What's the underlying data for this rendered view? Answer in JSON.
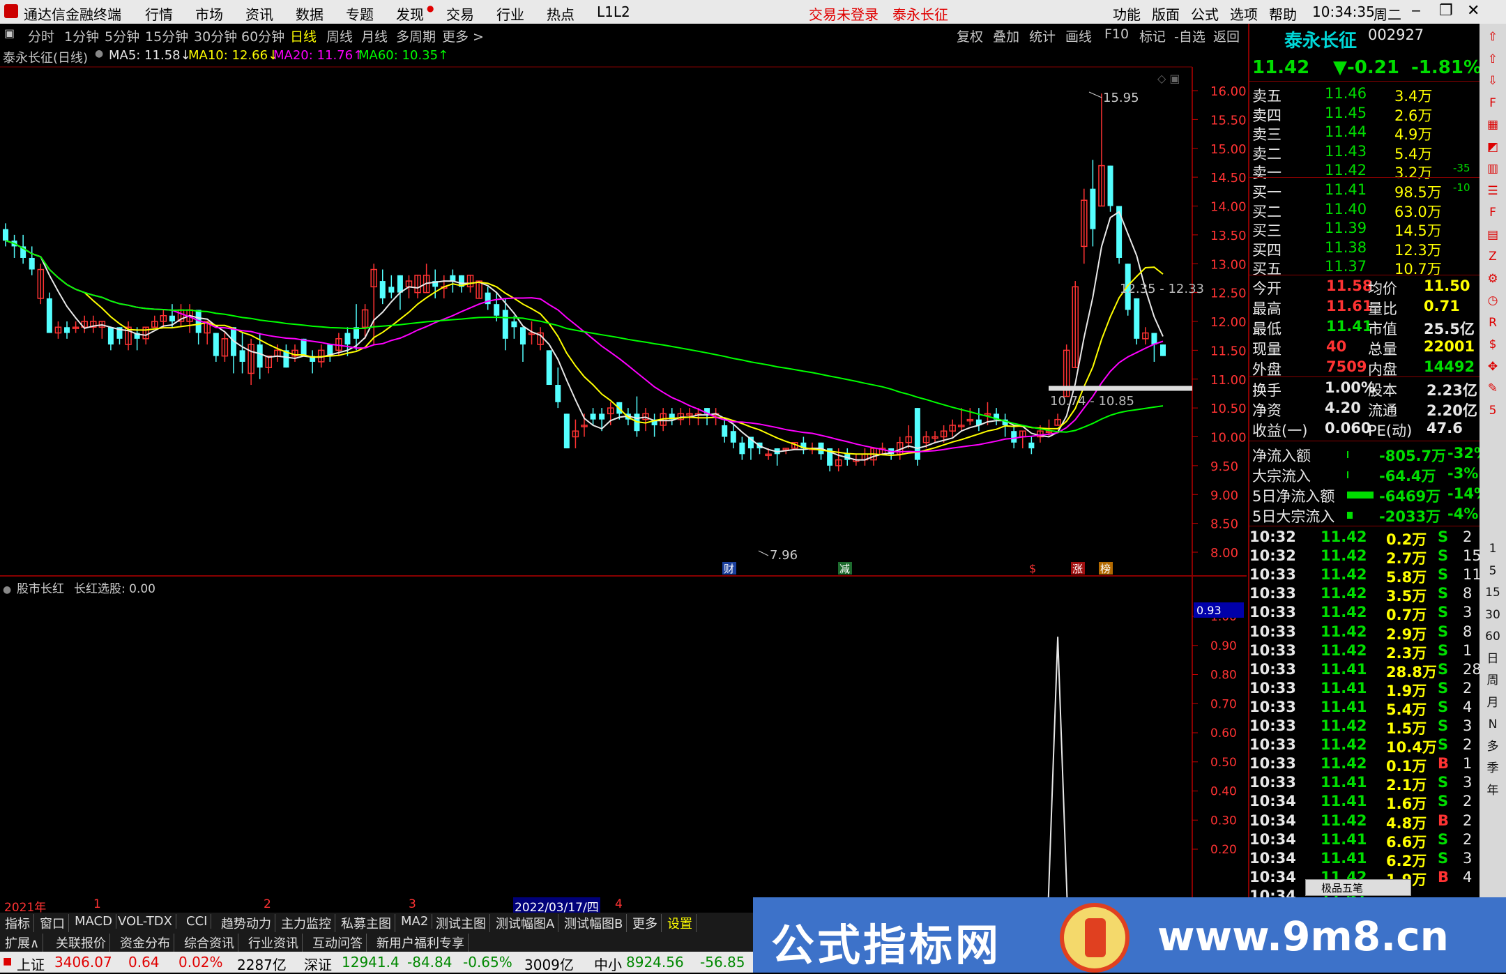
{
  "menubar": {
    "app_title": "通达信金融终端",
    "items": [
      "行情",
      "市场",
      "资讯",
      "数据",
      "专题",
      "发现",
      "交易",
      "行业",
      "热点",
      "L1L2"
    ],
    "notice1": "交易未登录",
    "notice2": "泰永长征",
    "right_items": [
      "功能",
      "版面",
      "公式",
      "选项",
      "帮助"
    ],
    "time": "10:34:35",
    "weekday": "周二"
  },
  "periods": [
    "分时",
    "1分钟",
    "5分钟",
    "15分钟",
    "30分钟",
    "60分钟",
    "日线",
    "周线",
    "月线",
    "多周期",
    "更多 >"
  ],
  "active_period": "日线",
  "tools": [
    "复权",
    "叠加",
    "统计",
    "画线",
    "F10",
    "标记",
    "-自选",
    "返回"
  ],
  "chart_title": {
    "stock": "泰永长征(日线)",
    "ma5": "MA5: 11.58↓",
    "ma10": "MA10: 12.66↓",
    "ma20": "MA20: 11.76↑",
    "ma60": "MA60: 10.35↑"
  },
  "price_axis": [
    "16.00",
    "15.50",
    "15.00",
    "14.50",
    "14.00",
    "13.50",
    "13.00",
    "12.50",
    "12.00",
    "11.50",
    "11.00",
    "10.50",
    "10.00",
    "9.50",
    "9.00",
    "8.50",
    "8.00"
  ],
  "annotations": {
    "high": "15.95",
    "low": "7.96",
    "range1": "12.35 - 12.33",
    "range2": "10.74 - 10.85",
    "events": [
      "财",
      "减",
      "$",
      "涨",
      "榜"
    ]
  },
  "indicator": {
    "title": "股市长红",
    "value_label": "长红选股: 0.00",
    "axis": [
      "1.00",
      "0.90",
      "0.80",
      "0.70",
      "0.60",
      "0.50",
      "0.40",
      "0.30",
      "0.20"
    ],
    "current": "0.93"
  },
  "time_axis": [
    "2021年",
    "1",
    "2",
    "3",
    "2022/03/17/四",
    "4"
  ],
  "tabs1": [
    "指标",
    "窗口",
    "MACD",
    "VOL-TDX",
    "CCI",
    "趋势动力",
    "主力监控",
    "私募主图",
    "MA2",
    "测试主图",
    "测试幅图A",
    "测试幅图B",
    "更多",
    "设置"
  ],
  "tabs2": [
    "扩展∧",
    "关联报价",
    "资金分布",
    "综合资讯",
    "行业资讯",
    "互动问答",
    "新用户福利专享"
  ],
  "status": {
    "sh_label": "上证",
    "sh_val": "3406.07",
    "sh_chg": "0.64",
    "sh_pct": "0.02%",
    "sh_amt": "2287亿",
    "sz_label": "深证",
    "sz_val": "12941.4",
    "sz_chg": "-84.84",
    "sz_pct": "-0.65%",
    "sz_amt": "3009亿",
    "zx_label": "中小",
    "zx_val": "8924.56",
    "zx_chg": "-56.85"
  },
  "quote": {
    "name": "泰永长征",
    "code": "002927",
    "price": "11.42",
    "change": "▼-0.21",
    "pct": "-1.81%",
    "asks": [
      {
        "label": "卖五",
        "price": "11.46",
        "vol": "3.4万",
        "chg": ""
      },
      {
        "label": "卖四",
        "price": "11.45",
        "vol": "2.6万",
        "chg": ""
      },
      {
        "label": "卖三",
        "price": "11.44",
        "vol": "4.9万",
        "chg": ""
      },
      {
        "label": "卖二",
        "price": "11.43",
        "vol": "5.4万",
        "chg": ""
      },
      {
        "label": "卖一",
        "price": "11.42",
        "vol": "3.2万",
        "chg": "-35"
      }
    ],
    "bids": [
      {
        "label": "买一",
        "price": "11.41",
        "vol": "98.5万",
        "chg": "-10"
      },
      {
        "label": "买二",
        "price": "11.40",
        "vol": "63.0万",
        "chg": ""
      },
      {
        "label": "买三",
        "price": "11.39",
        "vol": "14.5万",
        "chg": ""
      },
      {
        "label": "买四",
        "price": "11.38",
        "vol": "12.3万",
        "chg": ""
      },
      {
        "label": "买五",
        "price": "11.37",
        "vol": "10.7万",
        "chg": ""
      }
    ],
    "stats": [
      {
        "l1": "今开",
        "v1": "11.58",
        "l2": "均价",
        "v2": "11.50"
      },
      {
        "l1": "最高",
        "v1": "11.61",
        "l2": "量比",
        "v2": "0.71"
      },
      {
        "l1": "最低",
        "v1": "11.41",
        "l2": "市值",
        "v2": "25.5亿"
      },
      {
        "l1": "现量",
        "v1": "40",
        "l2": "总量",
        "v2": "22001"
      },
      {
        "l1": "外盘",
        "v1": "7509",
        "l2": "内盘",
        "v2": "14492"
      }
    ],
    "stats2": [
      {
        "l1": "换手",
        "v1": "1.00%",
        "l2": "股本",
        "v2": "2.23亿"
      },
      {
        "l1": "净资",
        "v1": "4.20",
        "l2": "流通",
        "v2": "2.20亿"
      },
      {
        "l1": "收益(一)",
        "v1": "0.060",
        "l2": "PE(动)",
        "v2": "47.6"
      }
    ],
    "flows": [
      {
        "label": "净流入额",
        "val": "-805.7万",
        "pct": "-32%"
      },
      {
        "label": "大宗流入",
        "val": "-64.4万",
        "pct": "-3%"
      },
      {
        "label": "5日净流入额",
        "val": "-6469万",
        "pct": "-14%"
      },
      {
        "label": "5日大宗流入",
        "val": "-2033万",
        "pct": "-4%"
      }
    ],
    "ticks": [
      {
        "t": "10:32",
        "p": "11.42",
        "v": "0.2万",
        "s": "S",
        "n": "2"
      },
      {
        "t": "10:32",
        "p": "11.42",
        "v": "2.7万",
        "s": "S",
        "n": "15"
      },
      {
        "t": "10:33",
        "p": "11.42",
        "v": "5.8万",
        "s": "S",
        "n": "11"
      },
      {
        "t": "10:33",
        "p": "11.42",
        "v": "3.5万",
        "s": "S",
        "n": "8"
      },
      {
        "t": "10:33",
        "p": "11.42",
        "v": "0.7万",
        "s": "S",
        "n": "3"
      },
      {
        "t": "10:33",
        "p": "11.42",
        "v": "2.9万",
        "s": "S",
        "n": "8"
      },
      {
        "t": "10:33",
        "p": "11.42",
        "v": "2.3万",
        "s": "S",
        "n": "1"
      },
      {
        "t": "10:33",
        "p": "11.41",
        "v": "28.8万",
        "s": "S",
        "n": "28"
      },
      {
        "t": "10:33",
        "p": "11.41",
        "v": "1.9万",
        "s": "S",
        "n": "2"
      },
      {
        "t": "10:33",
        "p": "11.41",
        "v": "5.4万",
        "s": "S",
        "n": "4"
      },
      {
        "t": "10:33",
        "p": "11.42",
        "v": "1.5万",
        "s": "S",
        "n": "3"
      },
      {
        "t": "10:33",
        "p": "11.42",
        "v": "10.4万",
        "s": "S",
        "n": "2"
      },
      {
        "t": "10:33",
        "p": "11.42",
        "v": "0.1万",
        "s": "B",
        "n": "1"
      },
      {
        "t": "10:33",
        "p": "11.41",
        "v": "2.1万",
        "s": "S",
        "n": "3"
      },
      {
        "t": "10:34",
        "p": "11.41",
        "v": "1.6万",
        "s": "S",
        "n": "2"
      },
      {
        "t": "10:34",
        "p": "11.42",
        "v": "4.8万",
        "s": "B",
        "n": "2"
      },
      {
        "t": "10:34",
        "p": "11.41",
        "v": "6.6万",
        "s": "S",
        "n": "2"
      },
      {
        "t": "10:34",
        "p": "11.41",
        "v": "6.2万",
        "s": "S",
        "n": "3"
      },
      {
        "t": "10:34",
        "p": "11.42",
        "v": "1.9万",
        "s": "B",
        "n": "4"
      },
      {
        "t": "10:34",
        "p": "11.41",
        "v": "",
        "s": "",
        "n": ""
      }
    ],
    "tick_popup": "极品五笔"
  },
  "side_icons": [
    "up-arrow",
    "up-arrow",
    "down-arrow",
    "f10-icon",
    "grid-icon",
    "chart-icon",
    "bars-icon",
    "list-icon",
    "fin-icon",
    "table-icon",
    "fz-icon",
    "gear-icon",
    "clock-icon",
    "rsi-icon",
    "dollar-icon",
    "move-icon",
    "pen-icon",
    "f5-icon"
  ],
  "side_labels": [
    "1",
    "5",
    "15",
    "30",
    "60",
    "日",
    "周",
    "月",
    "N",
    "多",
    "季",
    "年"
  ],
  "banner": {
    "text1": "公式指标网",
    "text2": "www.9m8.cn"
  },
  "chart_data": {
    "type": "candlestick",
    "price_range": [
      8.0,
      16.0
    ],
    "candles": [
      [
        13.6,
        13.4,
        13.7,
        13.3
      ],
      [
        13.4,
        13.3,
        13.5,
        13.1
      ],
      [
        13.3,
        13.1,
        13.5,
        13.0
      ],
      [
        13.1,
        12.9,
        13.3,
        12.8
      ],
      [
        12.4,
        12.9,
        13.0,
        12.3
      ],
      [
        12.4,
        11.8,
        12.5,
        11.8
      ],
      [
        11.8,
        11.9,
        12.0,
        11.7
      ],
      [
        11.9,
        11.8,
        12.0,
        11.7
      ],
      [
        11.9,
        11.9,
        12.0,
        11.8
      ],
      [
        11.9,
        12.0,
        12.1,
        11.8
      ],
      [
        11.9,
        12.0,
        12.1,
        11.8
      ],
      [
        11.9,
        12.0,
        12.0,
        11.7
      ],
      [
        11.9,
        11.6,
        11.9,
        11.5
      ],
      [
        11.9,
        11.7,
        11.9,
        11.6
      ],
      [
        11.6,
        11.9,
        12.0,
        11.5
      ],
      [
        11.8,
        11.7,
        11.9,
        11.5
      ],
      [
        11.7,
        11.9,
        11.9,
        11.6
      ],
      [
        11.9,
        12.0,
        12.1,
        11.9
      ],
      [
        12.0,
        12.1,
        12.2,
        11.9
      ],
      [
        12.1,
        12.0,
        12.3,
        11.9
      ],
      [
        12.0,
        12.2,
        12.3,
        11.9
      ],
      [
        12.0,
        12.2,
        12.3,
        11.8
      ],
      [
        12.2,
        11.8,
        12.2,
        11.6
      ],
      [
        11.8,
        12.0,
        12.0,
        11.6
      ],
      [
        11.8,
        11.4,
        11.8,
        11.3
      ],
      [
        11.4,
        11.7,
        11.8,
        11.3
      ],
      [
        11.9,
        11.4,
        11.9,
        11.1
      ],
      [
        11.5,
        11.3,
        11.8,
        11.1
      ],
      [
        11.1,
        11.6,
        11.7,
        10.9
      ],
      [
        11.6,
        11.2,
        11.8,
        11.0
      ],
      [
        11.2,
        11.4,
        11.4,
        11.1
      ],
      [
        11.4,
        11.5,
        11.6,
        11.3
      ],
      [
        11.5,
        11.2,
        11.6,
        11.2
      ],
      [
        11.4,
        11.5,
        11.6,
        11.3
      ],
      [
        11.7,
        11.4,
        11.7,
        11.4
      ],
      [
        11.4,
        11.3,
        11.5,
        11.1
      ],
      [
        11.3,
        11.5,
        11.6,
        11.2
      ],
      [
        11.6,
        11.4,
        11.6,
        11.3
      ],
      [
        11.5,
        11.7,
        11.8,
        11.4
      ],
      [
        11.8,
        11.6,
        11.9,
        11.4
      ],
      [
        11.9,
        11.7,
        12.3,
        11.5
      ],
      [
        11.9,
        12.2,
        12.3,
        11.7
      ],
      [
        12.6,
        12.9,
        13.0,
        11.6
      ],
      [
        12.7,
        12.4,
        12.9,
        12.3
      ],
      [
        12.6,
        12.5,
        12.8,
        12.4
      ],
      [
        12.8,
        12.5,
        12.8,
        12.2
      ],
      [
        12.6,
        12.7,
        12.8,
        12.4
      ],
      [
        12.5,
        12.8,
        12.8,
        12.4
      ],
      [
        12.5,
        12.8,
        13.0,
        12.5
      ],
      [
        12.7,
        12.6,
        12.9,
        12.4
      ],
      [
        12.6,
        12.6,
        12.8,
        12.4
      ],
      [
        12.8,
        12.7,
        12.9,
        12.5
      ],
      [
        12.8,
        12.6,
        12.8,
        12.5
      ],
      [
        12.6,
        12.8,
        12.8,
        12.5
      ],
      [
        12.4,
        12.7,
        12.7,
        12.4
      ],
      [
        12.5,
        12.3,
        12.6,
        12.2
      ],
      [
        12.3,
        12.1,
        12.5,
        12.0
      ],
      [
        12.2,
        11.7,
        12.4,
        11.5
      ],
      [
        12.0,
        11.9,
        12.1,
        11.7
      ],
      [
        11.9,
        11.6,
        11.9,
        11.3
      ],
      [
        11.8,
        11.8,
        12.0,
        11.6
      ],
      [
        11.6,
        11.8,
        11.9,
        11.5
      ],
      [
        11.5,
        10.9,
        11.5,
        10.9
      ],
      [
        10.9,
        10.6,
        11.2,
        10.5
      ],
      [
        10.4,
        9.8,
        10.4,
        9.8
      ],
      [
        10.0,
        10.1,
        10.3,
        9.8
      ],
      [
        10.2,
        10.2,
        10.4,
        10.0
      ],
      [
        10.4,
        10.3,
        10.5,
        10.2
      ],
      [
        10.4,
        10.3,
        10.5,
        10.1
      ],
      [
        10.4,
        10.5,
        10.6,
        10.2
      ],
      [
        10.6,
        10.4,
        10.6,
        10.3
      ],
      [
        10.4,
        10.3,
        10.5,
        10.2
      ],
      [
        10.4,
        10.1,
        10.7,
        10.0
      ],
      [
        10.3,
        10.4,
        10.5,
        10.1
      ],
      [
        10.3,
        10.2,
        10.4,
        10.0
      ],
      [
        10.2,
        10.4,
        10.5,
        10.1
      ],
      [
        10.4,
        10.3,
        10.5,
        10.2
      ],
      [
        10.3,
        10.4,
        10.5,
        10.2
      ],
      [
        10.4,
        10.4,
        10.5,
        10.2
      ],
      [
        10.4,
        10.4,
        10.5,
        10.2
      ],
      [
        10.5,
        10.4,
        10.5,
        10.2
      ],
      [
        10.4,
        10.4,
        10.5,
        10.2
      ],
      [
        10.2,
        10.0,
        10.3,
        9.9
      ],
      [
        10.1,
        9.9,
        10.2,
        9.8
      ],
      [
        9.9,
        9.7,
        10.0,
        9.6
      ],
      [
        10.0,
        9.8,
        10.0,
        9.6
      ],
      [
        9.9,
        9.8,
        9.9,
        9.7
      ],
      [
        9.7,
        9.7,
        9.8,
        9.6
      ],
      [
        9.8,
        9.7,
        9.8,
        9.5
      ],
      [
        9.8,
        9.8,
        9.8,
        9.7
      ],
      [
        9.8,
        9.9,
        9.9,
        9.8
      ],
      [
        9.9,
        9.8,
        10.0,
        9.7
      ],
      [
        9.8,
        9.8,
        9.9,
        9.7
      ],
      [
        9.9,
        9.7,
        9.9,
        9.6
      ],
      [
        9.8,
        9.5,
        9.8,
        9.4
      ]
    ],
    "tail_candles": [
      [
        9.5,
        9.6,
        9.8,
        9.4
      ],
      [
        9.7,
        9.6,
        9.8,
        9.5
      ],
      [
        9.6,
        9.6,
        9.7,
        9.5
      ],
      [
        9.6,
        9.7,
        9.8,
        9.5
      ],
      [
        9.6,
        9.8,
        9.8,
        9.5
      ],
      [
        9.7,
        9.8,
        9.9,
        9.7
      ],
      [
        9.8,
        9.7,
        9.8,
        9.6
      ],
      [
        9.7,
        9.9,
        10.0,
        9.6
      ],
      [
        9.9,
        10.0,
        10.2,
        9.8
      ],
      [
        10.5,
        9.6,
        10.5,
        9.5
      ],
      [
        9.9,
        10.0,
        10.1,
        9.8
      ],
      [
        10.0,
        10.0,
        10.1,
        9.9
      ],
      [
        10.0,
        10.1,
        10.2,
        9.9
      ],
      [
        10.1,
        10.2,
        10.3,
        10.0
      ],
      [
        10.2,
        10.2,
        10.5,
        10.1
      ],
      [
        10.3,
        10.3,
        10.5,
        10.2
      ],
      [
        10.3,
        10.2,
        10.5,
        10.1
      ],
      [
        10.4,
        10.4,
        10.6,
        10.2
      ],
      [
        10.4,
        10.3,
        10.5,
        10.2
      ],
      [
        10.3,
        10.2,
        10.4,
        10.0
      ],
      [
        10.1,
        9.9,
        10.2,
        9.8
      ],
      [
        10.0,
        10.1,
        10.1,
        9.8
      ],
      [
        9.9,
        9.8,
        10.0,
        9.7
      ],
      [
        10.0,
        10.1,
        10.2,
        9.9
      ],
      [
        10.1,
        10.1,
        10.3,
        10.0
      ],
      [
        10.2,
        10.3,
        10.4,
        10.2
      ],
      [
        10.7,
        11.5,
        11.6,
        10.7
      ],
      [
        11.2,
        12.6,
        12.7,
        11.2
      ],
      [
        13.3,
        14.1,
        14.3,
        13.0
      ],
      [
        14.3,
        13.6,
        14.8,
        13.3
      ],
      [
        14.0,
        14.7,
        15.95,
        14.0
      ],
      [
        14.7,
        14.0,
        14.7,
        13.9
      ],
      [
        14.0,
        13.1,
        14.0,
        13.0
      ],
      [
        13.0,
        12.2,
        13.0,
        12.1
      ],
      [
        12.4,
        11.7,
        12.4,
        11.6
      ],
      [
        11.7,
        11.8,
        11.9,
        11.6
      ],
      [
        11.8,
        11.6,
        11.8,
        11.3
      ],
      [
        11.6,
        11.4,
        11.6,
        11.4
      ]
    ],
    "indicator_peak_at": 0.93
  }
}
